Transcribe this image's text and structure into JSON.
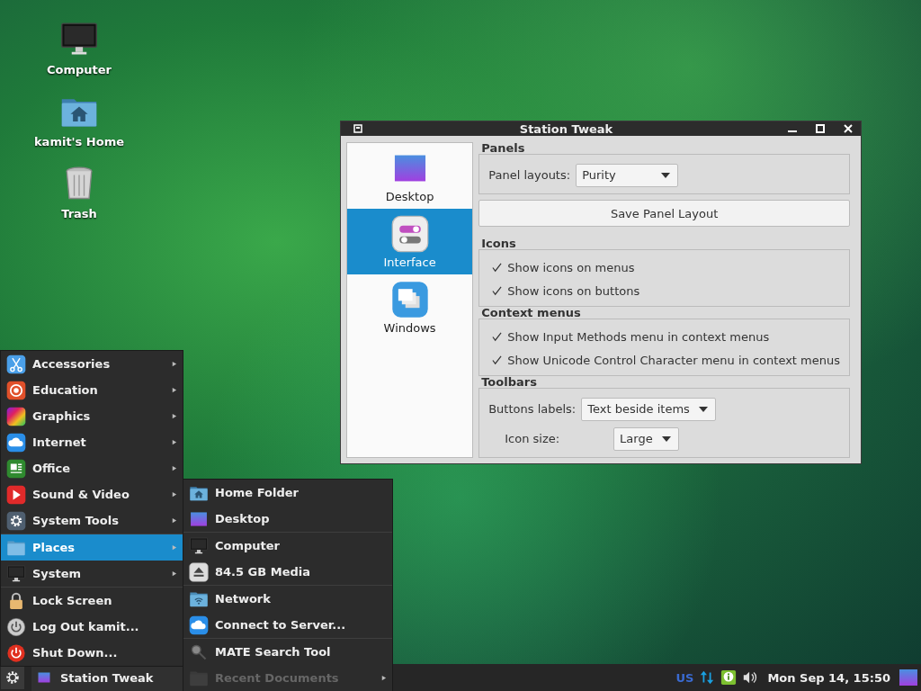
{
  "desktop_icons": [
    {
      "label": "Computer",
      "kind": "monitor"
    },
    {
      "label": "kamit's Home",
      "kind": "home-folder"
    },
    {
      "label": "Trash",
      "kind": "trash"
    }
  ],
  "window": {
    "title": "Station Tweak",
    "sidebar": [
      {
        "label": "Desktop",
        "kind": "desktop-image",
        "selected": false
      },
      {
        "label": "Interface",
        "kind": "toggles",
        "selected": true
      },
      {
        "label": "Windows",
        "kind": "windows",
        "selected": false
      }
    ],
    "sections": [
      {
        "kind": "fields",
        "title": "Panels",
        "fields": [
          {
            "label": "Panel layouts:",
            "value": "Purity"
          }
        ]
      },
      {
        "kind": "button",
        "label": "Save Panel Layout"
      },
      {
        "kind": "options",
        "title": "Icons",
        "options": [
          {
            "label": "Show icons on menus",
            "checked": true
          },
          {
            "label": "Show icons on buttons",
            "checked": true
          }
        ]
      },
      {
        "kind": "options",
        "title": "Context menus",
        "options": [
          {
            "label": "Show Input Methods menu in context menus",
            "checked": true
          },
          {
            "label": "Show Unicode Control Character menu in context menus",
            "checked": true
          }
        ]
      },
      {
        "kind": "fields",
        "title": "Toolbars",
        "fields": [
          {
            "label": "Buttons labels:",
            "value": "Text beside items"
          },
          {
            "label": "Icon size:",
            "value": "Large"
          }
        ]
      }
    ]
  },
  "menu": {
    "sections": [
      {
        "items": [
          {
            "label": "Accessories",
            "kind": "scissors",
            "submenu": true,
            "selected": false
          },
          {
            "label": "Education",
            "kind": "education",
            "submenu": true,
            "selected": false
          },
          {
            "label": "Graphics",
            "kind": "graphics",
            "submenu": true,
            "selected": false
          },
          {
            "label": "Internet",
            "kind": "cloud",
            "submenu": true,
            "selected": false
          },
          {
            "label": "Office",
            "kind": "office",
            "submenu": true,
            "selected": false
          },
          {
            "label": "Sound & Video",
            "kind": "play",
            "submenu": true,
            "selected": false
          },
          {
            "label": "System Tools",
            "kind": "gear",
            "submenu": true,
            "selected": false
          }
        ]
      },
      {
        "items": [
          {
            "label": "Places",
            "kind": "folder",
            "submenu": true,
            "selected": true
          },
          {
            "label": "System",
            "kind": "monitor",
            "submenu": true,
            "selected": false
          }
        ]
      },
      {
        "items": [
          {
            "label": "Lock Screen",
            "kind": "lock",
            "submenu": false,
            "selected": false
          },
          {
            "label": "Log Out kamit...",
            "kind": "power-grey",
            "submenu": false,
            "selected": false
          },
          {
            "label": "Shut Down...",
            "kind": "power-red",
            "submenu": false,
            "selected": false
          }
        ]
      }
    ]
  },
  "places_menu": {
    "sections": [
      {
        "items": [
          {
            "label": "Home Folder",
            "kind": "home-folder",
            "submenu": false,
            "disabled": false
          },
          {
            "label": "Desktop",
            "kind": "desktop-image",
            "submenu": false,
            "disabled": false
          }
        ]
      },
      {
        "items": [
          {
            "label": "Computer",
            "kind": "monitor",
            "submenu": false,
            "disabled": false
          },
          {
            "label": "84.5 GB Media",
            "kind": "eject",
            "submenu": false,
            "disabled": false
          }
        ]
      },
      {
        "items": [
          {
            "label": "Network",
            "kind": "network-folder",
            "submenu": false,
            "disabled": false
          },
          {
            "label": "Connect to Server...",
            "kind": "cloud",
            "submenu": false,
            "disabled": false
          }
        ]
      },
      {
        "items": [
          {
            "label": "MATE Search Tool",
            "kind": "search",
            "submenu": false,
            "disabled": false
          },
          {
            "label": "Recent Documents",
            "kind": "folder-dark",
            "submenu": true,
            "disabled": true
          }
        ]
      }
    ]
  },
  "taskbar": {
    "tasks": [
      {
        "label": "Station Tweak",
        "kind": "desktop-image"
      }
    ],
    "keyboard_layout": "US",
    "clock": "Mon Sep 14, 15:50"
  }
}
